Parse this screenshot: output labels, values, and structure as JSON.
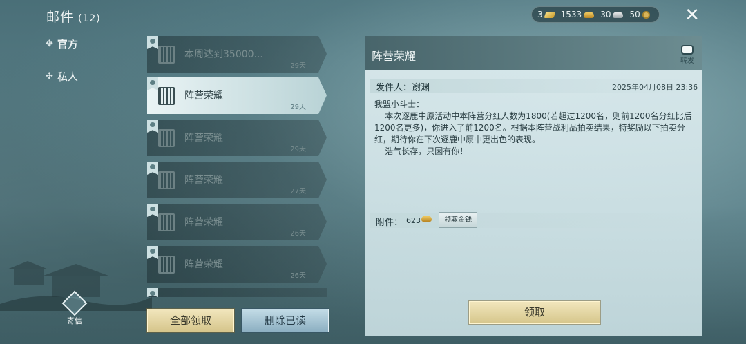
{
  "header": {
    "title": "邮件",
    "count": "(12)",
    "currency": {
      "gold_bar": "3",
      "gold_ingot": "1533",
      "silver_ingot": "30",
      "coin": "50"
    }
  },
  "nav": {
    "official": "官方",
    "private": "私人"
  },
  "mails": [
    {
      "subject": "本周达到35000...",
      "days": "29天",
      "active": false
    },
    {
      "subject": "阵营荣耀",
      "days": "29天",
      "active": true
    },
    {
      "subject": "阵营荣耀",
      "days": "29天",
      "active": false
    },
    {
      "subject": "阵营荣耀",
      "days": "27天",
      "active": false
    },
    {
      "subject": "阵营荣耀",
      "days": "26天",
      "active": false
    },
    {
      "subject": "阵营荣耀",
      "days": "26天",
      "active": false
    }
  ],
  "buttons": {
    "claim_all": "全部领取",
    "delete_read": "删除已读",
    "claim": "领取",
    "take_money": "领取金钱",
    "forward": "转发",
    "send": "寄信"
  },
  "detail": {
    "title": "阵营荣耀",
    "sender": "发件人：谢渊",
    "date": "2025年04月08日  23:36",
    "body": "我盟小斗士：\n    本次逐鹿中原活动中本阵营分红人数为1800(若超过1200名，则前1200名分红比后1200名更多)，你进入了前1200名。根据本阵营战利品拍卖结果，特奖励以下拍卖分红，期待你在下次逐鹿中原中更出色的表现。\n    浩气长存，只因有你！",
    "attachment_label": "附件：",
    "attachment_amount": "623"
  }
}
